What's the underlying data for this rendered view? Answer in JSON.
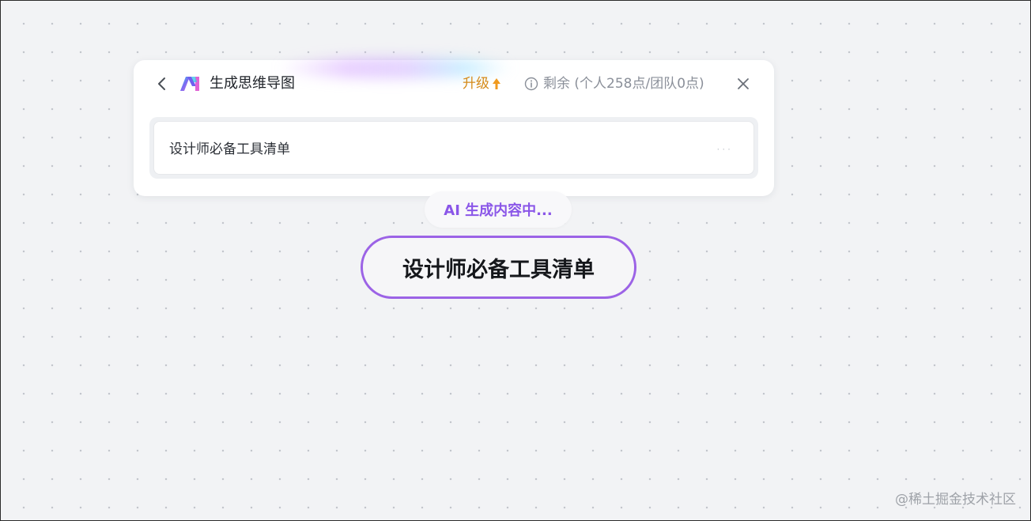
{
  "panel": {
    "title": "生成思维导图",
    "upgrade_label": "升级",
    "quota_text": "剩余 (个人258点/团队0点)",
    "input_value": "设计师必备工具清单",
    "loading_indicator": "···"
  },
  "status": {
    "text": "AI 生成内容中..."
  },
  "mindmap": {
    "root_label": "设计师必备工具清单"
  },
  "watermark": {
    "text": "@稀土掘金技术社区"
  },
  "colors": {
    "accent_purple": "#9c63e6",
    "status_purple": "#8a56e8",
    "upgrade_orange": "#d58a18",
    "canvas_bg": "#f2f3f5"
  },
  "icons": {
    "back": "chevron-left-icon",
    "logo": "ai-logo-icon",
    "upgrade": "arrow-up-icon",
    "info": "info-icon",
    "close": "close-icon"
  }
}
